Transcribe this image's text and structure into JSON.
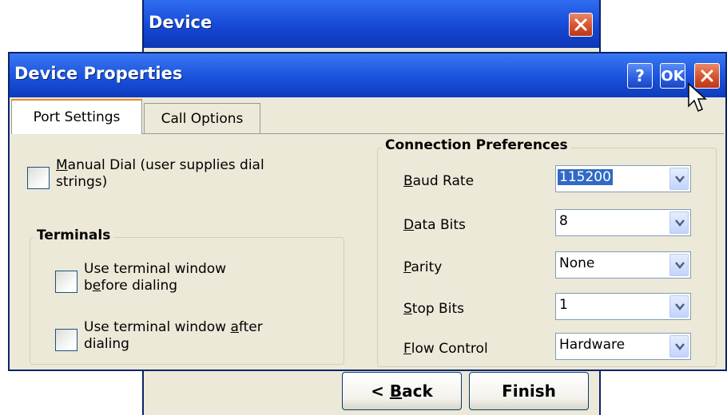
{
  "background_dialog": {
    "title": "Device",
    "back_button": "< Back",
    "back_button_mnemonic": "B",
    "finish_button": "Finish"
  },
  "dialog": {
    "title": "Device Properties",
    "help_button": "?",
    "ok_button": "OK"
  },
  "tabs": [
    {
      "label": "Port Settings",
      "selected": true
    },
    {
      "label": "Call Options",
      "selected": false
    }
  ],
  "manual_dial": {
    "label_line1": "Manual Dial (user supplies dial",
    "label_line2": "strings)",
    "checked": false
  },
  "terminals": {
    "title": "Terminals",
    "before": {
      "label_line1": "Use terminal window",
      "label_line2": "before dialing",
      "checked": false
    },
    "after": {
      "label_line1": "Use terminal window after",
      "label_line2": "dialing",
      "checked": false
    }
  },
  "connection": {
    "title": "Connection Preferences",
    "fields": [
      {
        "label": "Baud Rate",
        "value": "115200"
      },
      {
        "label": "Data Bits",
        "value": "8"
      },
      {
        "label": "Parity",
        "value": "None"
      },
      {
        "label": "Stop Bits",
        "value": "1"
      },
      {
        "label": "Flow Control",
        "value": "Hardware"
      }
    ]
  },
  "colors": {
    "titlebar": "#1a52dc",
    "dialog_bg": "#ece9d8",
    "close_red": "#d7522b",
    "selection": "#316ac5"
  },
  "icons": [
    "close-icon",
    "help-icon",
    "ok-icon",
    "dropdown-arrow-icon",
    "mouse-cursor-icon"
  ]
}
